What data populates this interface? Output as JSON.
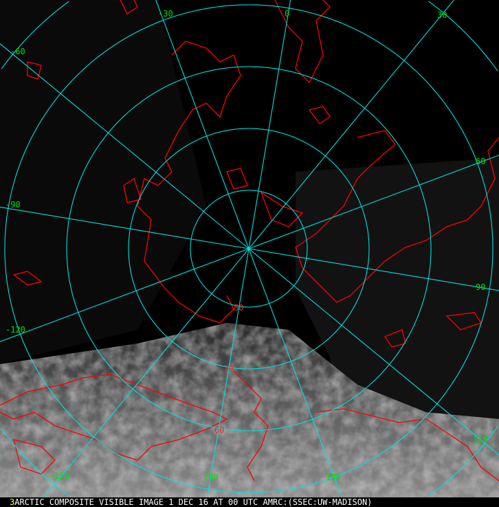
{
  "image": {
    "frame_number": "3",
    "caption": "ARCTIC COMPOSITE VISIBLE IMAGE 1 DEC 16 AT 00 UTC AMRC:(SSEC:UW-MADISON)"
  },
  "colors": {
    "grid": "#00e0e0",
    "coast": "#ff0000",
    "lon_label": "#00e000",
    "lat_label": "#ff2020",
    "frame_number": "#ffff00"
  },
  "latitude_labels": [
    "80",
    "70",
    "60"
  ],
  "longitude_labels": [
    "-30",
    "0",
    "30",
    "-60",
    "60",
    "-90",
    "90",
    "-120",
    "120",
    "-150",
    "180",
    "150"
  ]
}
